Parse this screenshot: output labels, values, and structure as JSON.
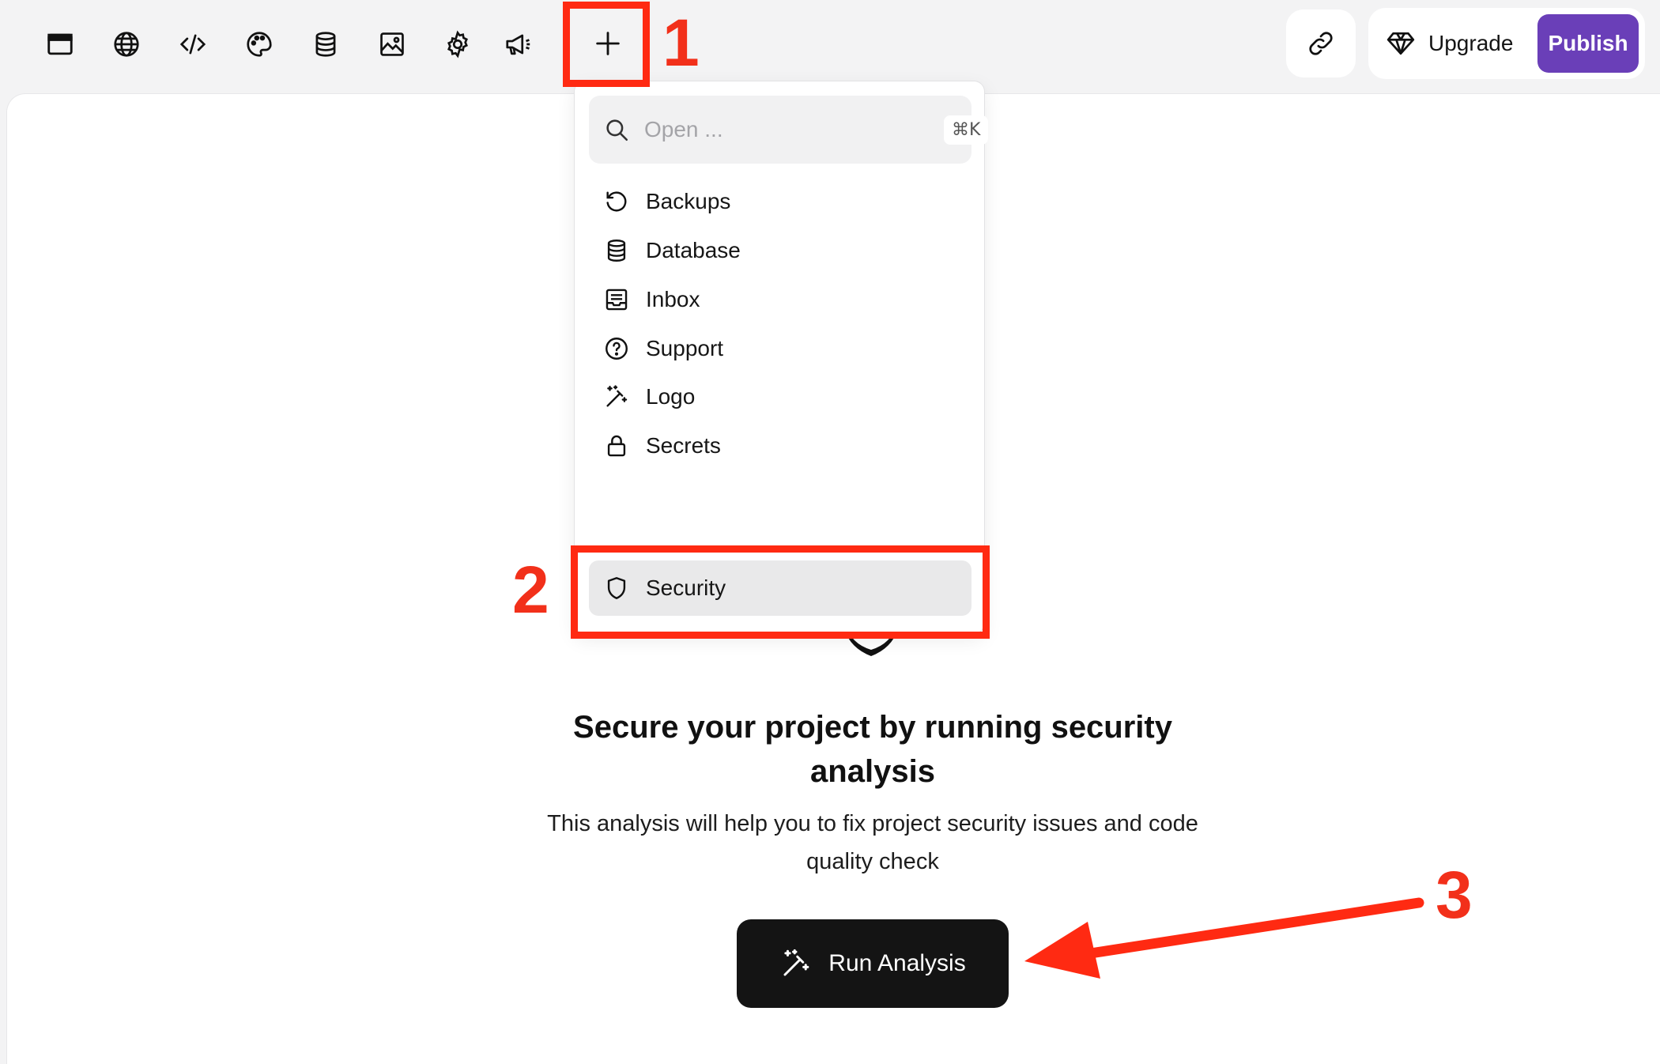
{
  "toolbar": {
    "icons": [
      {
        "name": "browser-window-icon"
      },
      {
        "name": "globe-icon"
      },
      {
        "name": "code-icon"
      },
      {
        "name": "palette-icon"
      },
      {
        "name": "database-icon"
      },
      {
        "name": "image-icon"
      },
      {
        "name": "gear-icon"
      },
      {
        "name": "megaphone-icon"
      }
    ],
    "plus_icon": "plus-icon",
    "link_icon": "link-icon",
    "upgrade_label": "Upgrade",
    "publish_label": "Publish"
  },
  "menu": {
    "search_placeholder": "Open ...",
    "search_shortcut": "⌘K",
    "items": [
      {
        "label": "Backups",
        "icon": "history-icon"
      },
      {
        "label": "Database",
        "icon": "database-icon"
      },
      {
        "label": "Inbox",
        "icon": "inbox-icon"
      },
      {
        "label": "Support",
        "icon": "help-circle-icon"
      },
      {
        "label": "Logo",
        "icon": "magic-wand-icon"
      },
      {
        "label": "Secrets",
        "icon": "lock-icon"
      },
      {
        "label": "Security",
        "icon": "shield-icon",
        "active": true
      }
    ]
  },
  "main": {
    "title": "Secure your project by running security analysis",
    "subtitle": "This analysis will help you to fix project security issues and code quality check",
    "run_label": "Run Analysis"
  },
  "annotations": {
    "step1": "1",
    "step2": "2",
    "step3": "3",
    "color": "#ff2a12"
  },
  "colors": {
    "publish": "#6a3fb8",
    "run_button": "#141414",
    "active_item": "#e9e9ea"
  }
}
